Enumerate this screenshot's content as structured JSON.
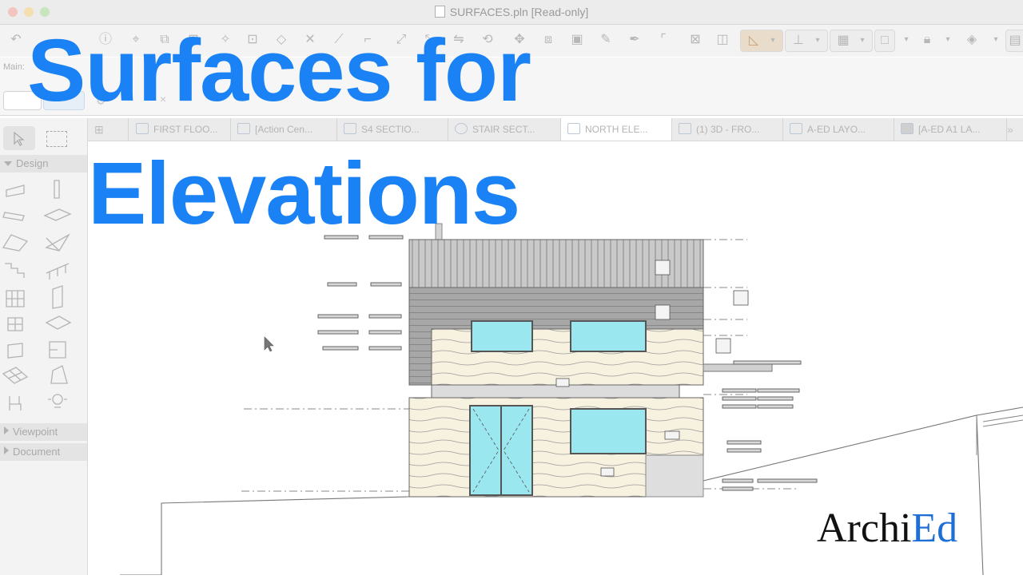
{
  "window": {
    "title": "SURFACES.pln [Read-only]"
  },
  "toolbar": {
    "main_label": "Main:"
  },
  "tabs": [
    {
      "label": "FIRST FLOO...",
      "icon": "floor-plan-icon"
    },
    {
      "label": "[Action Cen...",
      "icon": "action-center-icon"
    },
    {
      "label": "S4 SECTIO...",
      "icon": "section-icon"
    },
    {
      "label": "STAIR SECT...",
      "icon": "stair-section-icon"
    },
    {
      "label": "NORTH ELE...",
      "icon": "elevation-icon",
      "active": true
    },
    {
      "label": "(1) 3D - FRO...",
      "icon": "3d-icon"
    },
    {
      "label": "A-ED LAYO...",
      "icon": "layout-icon"
    },
    {
      "label": "[A-ED A1 LA...",
      "icon": "layout-book-icon"
    }
  ],
  "sidebar": {
    "sections": [
      {
        "label": "Design",
        "expanded": true
      },
      {
        "label": "Viewpoint",
        "expanded": false
      },
      {
        "label": "Document",
        "expanded": false
      }
    ]
  },
  "overlay": {
    "title_line1": "Surfaces for",
    "title_line2": "Elevations",
    "color": "#1a82f4"
  },
  "logo": {
    "part1": "Archi",
    "part2": "Ed",
    "accent_color": "#1d6fd6"
  }
}
